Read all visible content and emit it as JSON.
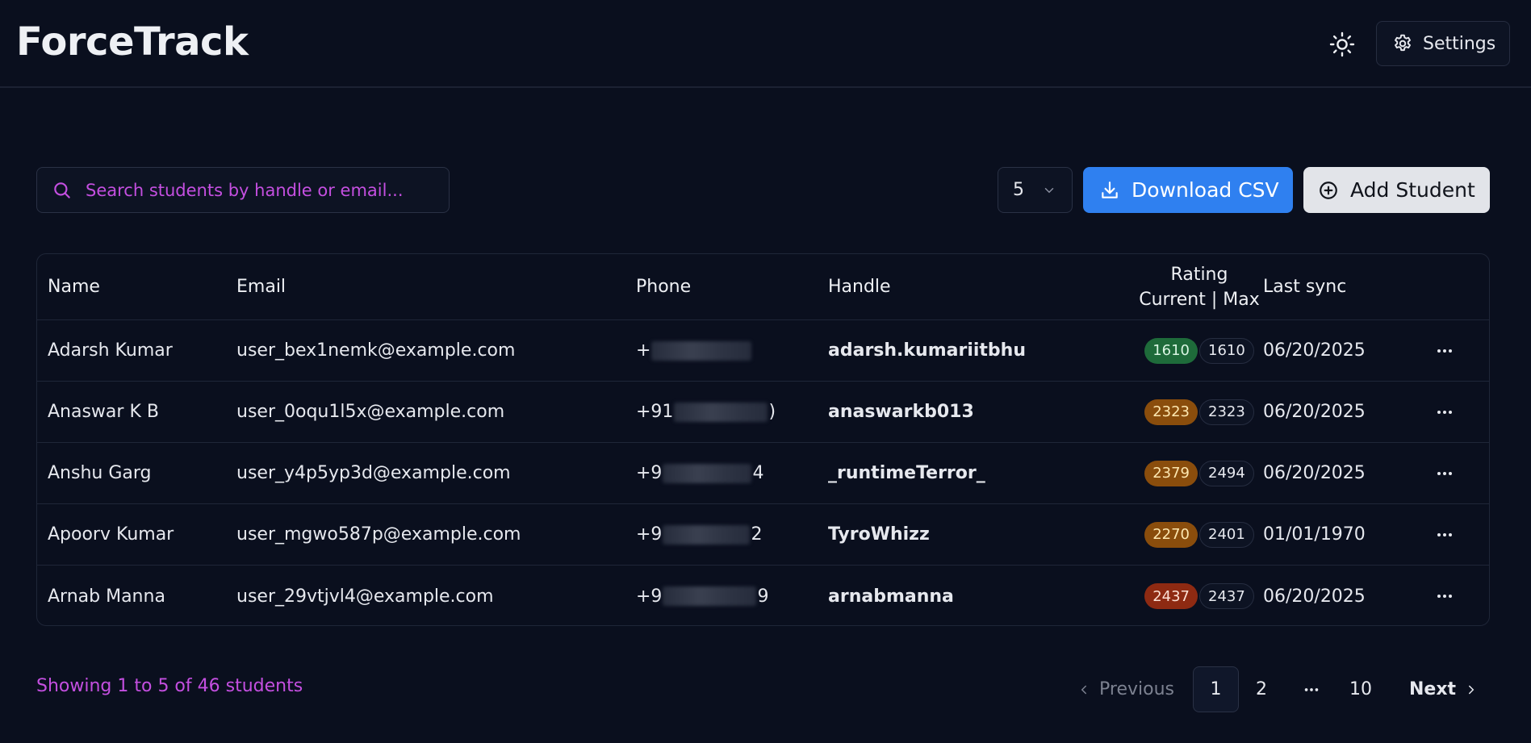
{
  "app": {
    "title": "ForceTrack"
  },
  "header": {
    "settings_label": "Settings",
    "theme_icon": "sun-icon"
  },
  "toolbar": {
    "search_placeholder": "Search students by handle or email...",
    "page_size": "5",
    "download_label": "Download CSV",
    "add_label": "Add Student"
  },
  "table": {
    "columns": {
      "name": "Name",
      "email": "Email",
      "phone": "Phone",
      "handle": "Handle",
      "rating_line1": "Rating",
      "rating_line2": "Current | Max",
      "last_sync": "Last sync"
    },
    "rows": [
      {
        "name": "Adarsh Kumar",
        "email": "user_bex1nemk@example.com",
        "phone_prefix": "+",
        "phone_suffix": "",
        "handle": "adarsh.kumariitbhu",
        "rating_current": "1610",
        "rating_max": "1610",
        "last_sync": "06/20/2025"
      },
      {
        "name": "Anaswar K B",
        "email": "user_0oqu1l5x@example.com",
        "phone_prefix": "+91",
        "phone_suffix": ")",
        "handle": "anaswarkb013",
        "rating_current": "2323",
        "rating_max": "2323",
        "last_sync": "06/20/2025"
      },
      {
        "name": "Anshu Garg",
        "email": "user_y4p5yp3d@example.com",
        "phone_prefix": "+9",
        "phone_suffix": "4",
        "handle": "_runtimeTerror_",
        "rating_current": "2379",
        "rating_max": "2494",
        "last_sync": "06/20/2025"
      },
      {
        "name": "Apoorv Kumar",
        "email": "user_mgwo587p@example.com",
        "phone_prefix": "+9",
        "phone_suffix": "2",
        "handle": "TyroWhizz",
        "rating_current": "2270",
        "rating_max": "2401",
        "last_sync": "01/01/1970"
      },
      {
        "name": "Arnab Manna",
        "email": "user_29vtjvl4@example.com",
        "phone_prefix": "+9",
        "phone_suffix": "9",
        "handle": "arnabmanna",
        "rating_current": "2437",
        "rating_max": "2437",
        "last_sync": "06/20/2025"
      }
    ]
  },
  "footer": {
    "showing": "Showing 1 to 5 of 46 students",
    "previous": "Previous",
    "next": "Next",
    "pages": [
      "1",
      "2",
      "10"
    ],
    "ellipsis": "…"
  },
  "colors": {
    "background": "#0a0f1e",
    "accent_purple": "#c44fe0",
    "download_blue": "#2f80f0",
    "badge_green": "#1e6b3a",
    "badge_orange": "#8a4d0c",
    "badge_red": "#8e2a12"
  }
}
